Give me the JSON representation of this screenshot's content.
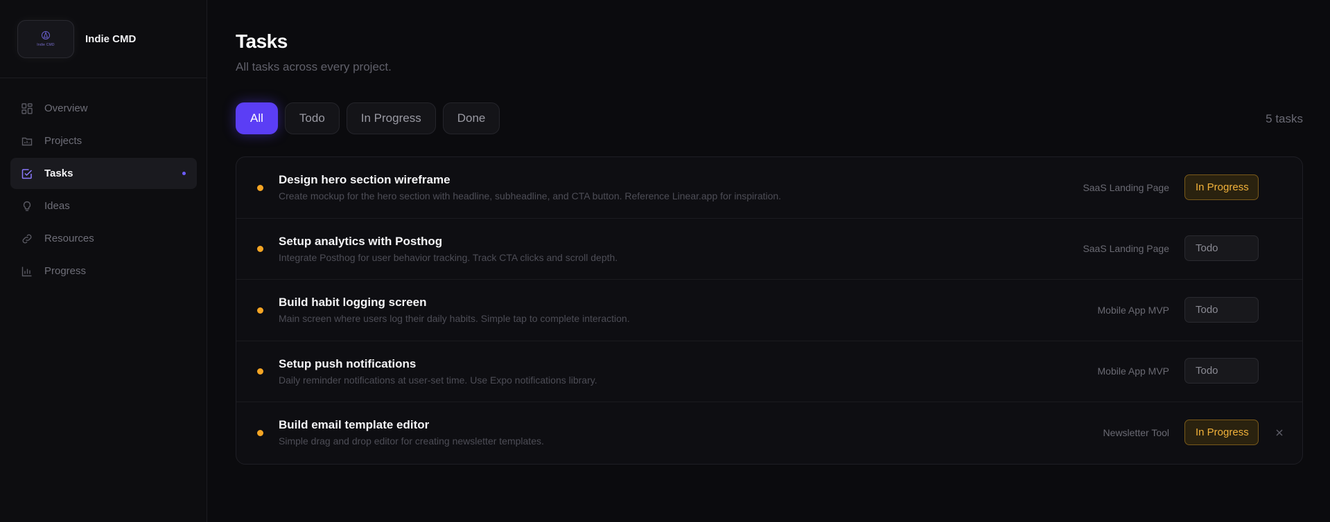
{
  "brand": {
    "name": "Indie CMD",
    "logo_text": "Indie CMD"
  },
  "sidebar": {
    "items": [
      {
        "label": "Overview",
        "icon": "grid-icon",
        "active": false
      },
      {
        "label": "Projects",
        "icon": "folder-icon",
        "active": false
      },
      {
        "label": "Tasks",
        "icon": "checkbox-icon",
        "active": true
      },
      {
        "label": "Ideas",
        "icon": "lightbulb-icon",
        "active": false
      },
      {
        "label": "Resources",
        "icon": "link-icon",
        "active": false
      },
      {
        "label": "Progress",
        "icon": "bar-chart-icon",
        "active": false
      }
    ]
  },
  "header": {
    "title": "Tasks",
    "subtitle": "All tasks across every project."
  },
  "filters": {
    "tabs": [
      {
        "label": "All",
        "active": true
      },
      {
        "label": "Todo",
        "active": false
      },
      {
        "label": "In Progress",
        "active": false
      },
      {
        "label": "Done",
        "active": false
      }
    ],
    "count": "5 tasks"
  },
  "tasks": [
    {
      "title": "Design hero section wireframe",
      "description": "Create mockup for the hero section with headline, subheadline, and CTA button. Reference Linear.app for inspiration.",
      "project": "SaaS Landing Page",
      "status": "In Progress"
    },
    {
      "title": "Setup analytics with Posthog",
      "description": "Integrate Posthog for user behavior tracking. Track CTA clicks and scroll depth.",
      "project": "SaaS Landing Page",
      "status": "Todo"
    },
    {
      "title": "Build habit logging screen",
      "description": "Main screen where users log their daily habits. Simple tap to complete interaction.",
      "project": "Mobile App MVP",
      "status": "Todo"
    },
    {
      "title": "Setup push notifications",
      "description": "Daily reminder notifications at user-set time. Use Expo notifications library.",
      "project": "Mobile App MVP",
      "status": "Todo"
    },
    {
      "title": "Build email template editor",
      "description": "Simple drag and drop editor for creating newsletter templates.",
      "project": "Newsletter Tool",
      "status": "In Progress"
    }
  ],
  "colors": {
    "accent": "#5b3ef5",
    "in_progress": "#f2b23a",
    "task_dot": "#f5a524",
    "background": "#0b0b0e"
  }
}
